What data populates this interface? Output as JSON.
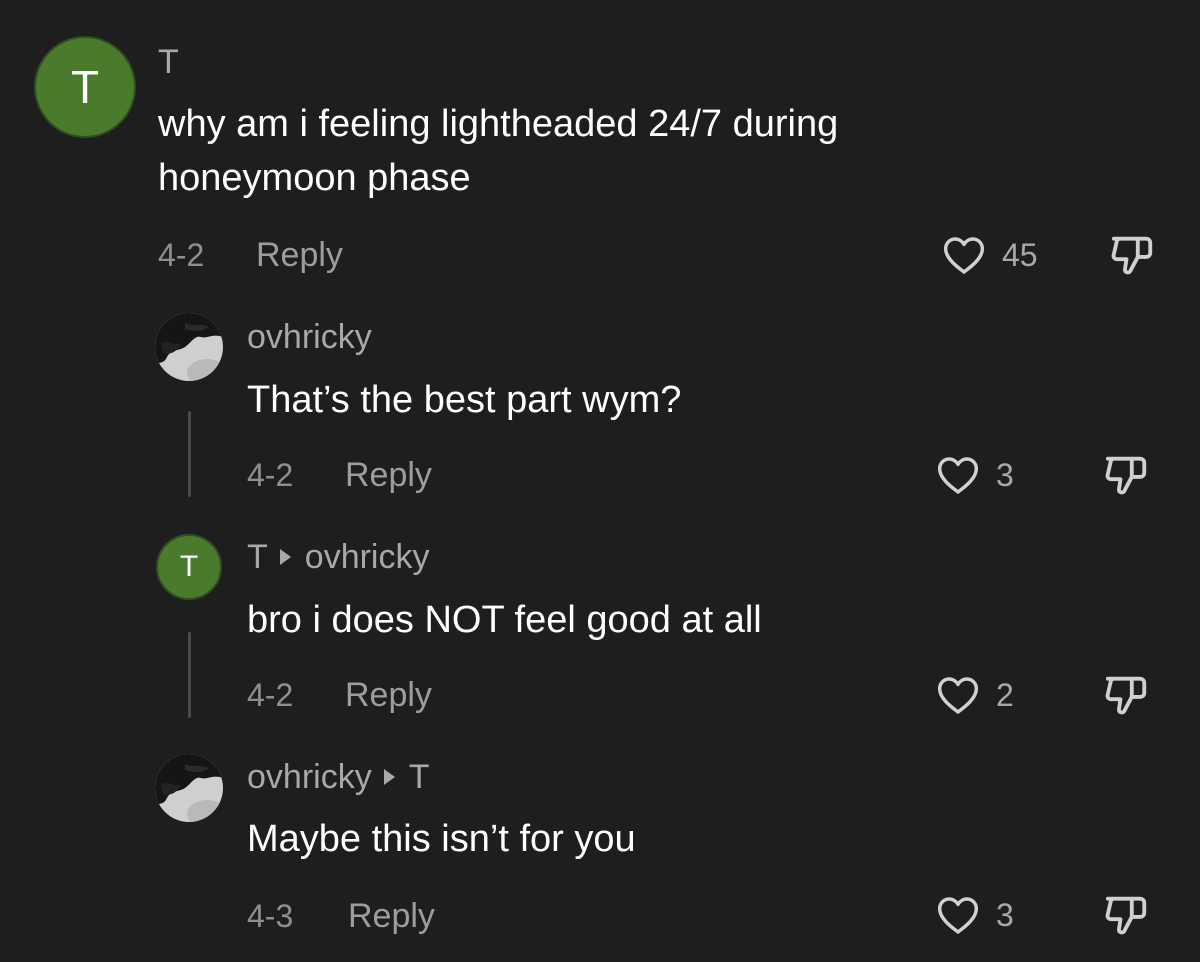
{
  "comments": [
    {
      "avatar_letter": "T",
      "author": "T",
      "text_line1": "why am i feeling lightheaded 24/7 during",
      "text_line2": "honeymoon phase",
      "date": "4-2",
      "reply_label": "Reply",
      "likes": "45"
    },
    {
      "author": "ovhricky",
      "text": "That’s the best part wym?",
      "date": "4-2",
      "reply_label": "Reply",
      "likes": "3"
    },
    {
      "avatar_letter": "T",
      "author": "T",
      "reply_to": "ovhricky",
      "text": "bro i does NOT feel good at all",
      "date": "4-2",
      "reply_label": "Reply",
      "likes": "2"
    },
    {
      "author": "ovhricky",
      "reply_to": "T",
      "text": "Maybe this isn’t for you",
      "date": "4-3",
      "reply_label": "Reply",
      "likes": "3"
    }
  ],
  "icons": {
    "like": "heart-outline-icon",
    "dislike": "thumbs-down-icon"
  },
  "colors": {
    "background": "#1e1e1e",
    "avatar_green": "#4a7a2c",
    "secondary_text": "#a8a8a8"
  }
}
